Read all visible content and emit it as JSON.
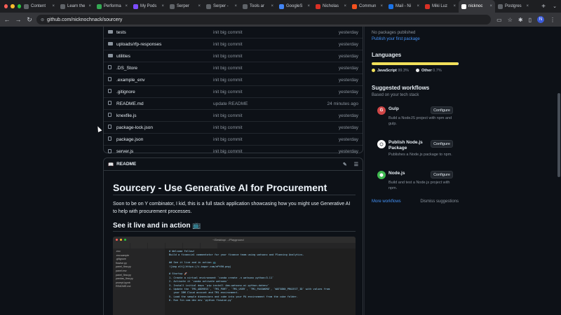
{
  "browser": {
    "tabs": [
      {
        "label": "Content",
        "color": "#5f6368"
      },
      {
        "label": "Learn the",
        "color": "#5f6368"
      },
      {
        "label": "Performa",
        "color": "#34a853"
      },
      {
        "label": "My Pods",
        "color": "#7c4dff"
      },
      {
        "label": "Serper",
        "color": "#5f6368"
      },
      {
        "label": "Serper -",
        "color": "#5f6368"
      },
      {
        "label": "Tools ar",
        "color": "#5f6368"
      },
      {
        "label": "GoogleS",
        "color": "#4285f4"
      },
      {
        "label": "Nicholas",
        "color": "#d93025"
      },
      {
        "label": "Commun",
        "color": "#f4511e"
      },
      {
        "label": "Mail - Ni",
        "color": "#1a73e8"
      },
      {
        "label": "Miki Luz",
        "color": "#d93025"
      },
      {
        "label": "nicknoc",
        "color": "#ffffff"
      },
      {
        "label": "Postgres",
        "color": "#5f6368"
      }
    ],
    "active_tab": 12,
    "url": "github.com/nicknochnack/sourcery",
    "profile_initial": "N"
  },
  "files": [
    {
      "type": "folder",
      "name": "tests",
      "message": "init big commit",
      "date": "yesterday"
    },
    {
      "type": "folder",
      "name": "uploads/rfp-responses",
      "message": "init big commit",
      "date": "yesterday"
    },
    {
      "type": "folder",
      "name": "utilities",
      "message": "init big commit",
      "date": "yesterday"
    },
    {
      "type": "file",
      "name": ".DS_Store",
      "message": "init big commit",
      "date": "yesterday"
    },
    {
      "type": "file",
      "name": ".example_env",
      "message": "init big commit",
      "date": "yesterday"
    },
    {
      "type": "file",
      "name": ".gitignore",
      "message": "init big commit",
      "date": "yesterday"
    },
    {
      "type": "file",
      "name": "README.md",
      "message": "update README",
      "date": "24 minutes ago"
    },
    {
      "type": "file",
      "name": "knexfile.js",
      "message": "init big commit",
      "date": "yesterday"
    },
    {
      "type": "file",
      "name": "package-lock.json",
      "message": "init big commit",
      "date": "yesterday"
    },
    {
      "type": "file",
      "name": "package.json",
      "message": "init big commit",
      "date": "yesterday"
    },
    {
      "type": "file",
      "name": "server.js",
      "message": "init big commit",
      "date": "yesterday"
    }
  ],
  "readme": {
    "label": "README",
    "title": "Sourcery - Use Generative AI for Procurement",
    "intro": "Soon to be on Y combinator, I kid, this is a full stack application showcasing how you might use Generative AI to help with procurement processes.",
    "section_title": "See it live and in action 📺",
    "screenshot": {
      "window_title": "~/Desktop/…/Playground",
      "files": [
        ".env",
        ".env.sample",
        ".gitignore",
        "flowise.py",
        "panel_flow.py",
        "panel.env",
        "panel_flow.py",
        "pandas_flow.py",
        "prompt.ipynb",
        "README.md"
      ],
      "code": [
        "# Welcome Fellow!",
        "Build a financial commentator for your finance team using watsonx and Planning Analytics.",
        "",
        "## See it live and in action 📺",
        "![img alt](https://i.imgur.com/ePtRH.png)",
        "",
        "# Startup 🚀",
        "1. Create a virtual environment `conda create -n watsonx python=3.11`",
        "2. Activate it `conda activate watsonx`",
        "3. Install initial deps `pip install ibm-watsonx-ai python-dotenv`",
        "4. Update the `TM1_ADDRESS`, `TM1_PORT`, `TM1_USER`, `TM1_PASSWORD`, `WATSONX_PROJECT_ID` with values from",
        "   your IBM Cloud account and TM1 environment.",
        "5. Load the sample dimensions and cube into your PA environment from the cube folder.",
        "6. Run fin com dev env `python flowise.py`"
      ]
    }
  },
  "sidebar": {
    "packages_none": "No packages published",
    "packages_link": "Publish your first package",
    "languages_title": "Languages",
    "languages": [
      {
        "name": "JavaScript",
        "percent": "99.3%",
        "value": 99.3,
        "color": "#f1e05a"
      },
      {
        "name": "Other",
        "percent": "0.7%",
        "value": 0.7,
        "color": "#ededed"
      }
    ],
    "workflows_title": "Suggested workflows",
    "workflows_sub": "Based on your tech stack",
    "workflows": [
      {
        "name": "Gulp",
        "desc": "Build a NodeJS project with npm and gulp.",
        "button": "Configure",
        "icon_bg": "#cf4647",
        "icon_glyph": "G"
      },
      {
        "name": "Publish Node.js Package",
        "desc": "Publishes a Node.js package to npm.",
        "button": "Configure",
        "icon_bg": "#ffffff",
        "icon_glyph": "⬡"
      },
      {
        "name": "Node.js",
        "desc": "Build and test a Node.js project with npm.",
        "button": "Configure",
        "icon_bg": "#3fb950",
        "icon_glyph": "⬢"
      }
    ],
    "more_workflows": "More workflows",
    "dismiss": "Dismiss suggestions"
  }
}
